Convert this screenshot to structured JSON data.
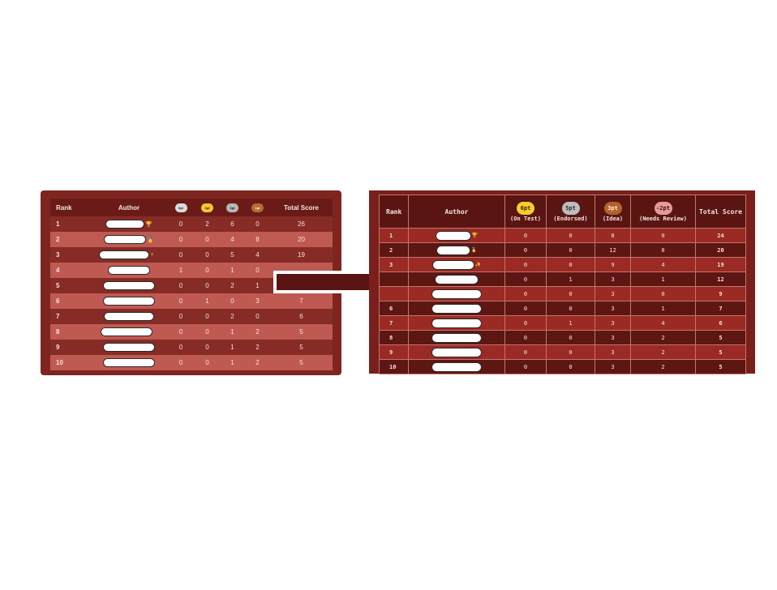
{
  "old_table": {
    "headers": {
      "rank": "Rank",
      "author": "Author",
      "badge_6pt": "6pt",
      "badge_4pt": "4pt",
      "badge_3pt": "3pt",
      "badge_1pt": "1pt",
      "total": "Total Score"
    },
    "rows": [
      {
        "rank": "1",
        "medal": "🏆",
        "c1": "0",
        "c2": "2",
        "c3": "6",
        "c4": "0",
        "total": "26"
      },
      {
        "rank": "2",
        "medal": "🥇",
        "c1": "0",
        "c2": "0",
        "c3": "4",
        "c4": "8",
        "total": "20"
      },
      {
        "rank": "3",
        "medal": "+",
        "c1": "0",
        "c2": "0",
        "c3": "5",
        "c4": "4",
        "total": "19"
      },
      {
        "rank": "4",
        "medal": "",
        "c1": "1",
        "c2": "0",
        "c3": "1",
        "c4": "0",
        "total": ""
      },
      {
        "rank": "5",
        "medal": "",
        "c1": "0",
        "c2": "0",
        "c3": "2",
        "c4": "1",
        "total": ""
      },
      {
        "rank": "6",
        "medal": "",
        "c1": "0",
        "c2": "1",
        "c3": "0",
        "c4": "3",
        "total": "7"
      },
      {
        "rank": "7",
        "medal": "",
        "c1": "0",
        "c2": "0",
        "c3": "2",
        "c4": "0",
        "total": "6"
      },
      {
        "rank": "8",
        "medal": "",
        "c1": "0",
        "c2": "0",
        "c3": "1",
        "c4": "2",
        "total": "5"
      },
      {
        "rank": "9",
        "medal": "",
        "c1": "0",
        "c2": "0",
        "c3": "1",
        "c4": "2",
        "total": "5"
      },
      {
        "rank": "10",
        "medal": "",
        "c1": "0",
        "c2": "0",
        "c3": "1",
        "c4": "2",
        "total": "5"
      }
    ]
  },
  "new_table": {
    "headers": {
      "rank": "Rank",
      "author": "Author",
      "badge_6pt": "6pt",
      "sub_6pt": "(On Test)",
      "badge_5pt": "5pt",
      "sub_5pt": "(Endorsed)",
      "badge_3pt": "3pt",
      "sub_3pt": "(Idea)",
      "badge_m2pt": "-2pt",
      "sub_m2pt": "(Needs Review)",
      "total": "Total Score"
    },
    "rows": [
      {
        "rank": "1",
        "medal": "🏆",
        "c1": "0",
        "c2": "0",
        "c3": "8",
        "c4": "0",
        "total": "24"
      },
      {
        "rank": "2",
        "medal": "🥇",
        "c1": "0",
        "c2": "0",
        "c3": "12",
        "c4": "8",
        "total": "20"
      },
      {
        "rank": "3",
        "medal": "✨",
        "c1": "0",
        "c2": "0",
        "c3": "9",
        "c4": "4",
        "total": "19"
      },
      {
        "rank": "",
        "medal": "",
        "c1": "0",
        "c2": "1",
        "c3": "3",
        "c4": "1",
        "total": "12"
      },
      {
        "rank": "",
        "medal": "",
        "c1": "0",
        "c2": "0",
        "c3": "3",
        "c4": "0",
        "total": "9"
      },
      {
        "rank": "6",
        "medal": "",
        "c1": "0",
        "c2": "0",
        "c3": "3",
        "c4": "1",
        "total": "7"
      },
      {
        "rank": "7",
        "medal": "",
        "c1": "0",
        "c2": "1",
        "c3": "3",
        "c4": "4",
        "total": "6"
      },
      {
        "rank": "8",
        "medal": "",
        "c1": "0",
        "c2": "0",
        "c3": "3",
        "c4": "2",
        "total": "5"
      },
      {
        "rank": "9",
        "medal": "",
        "c1": "0",
        "c2": "0",
        "c3": "3",
        "c4": "2",
        "total": "5"
      },
      {
        "rank": "10",
        "medal": "",
        "c1": "0",
        "c2": "0",
        "c3": "3",
        "c4": "2",
        "total": "5"
      }
    ]
  },
  "colors": {
    "old_row_odd": "#862b25",
    "old_row_even": "#bf5a52",
    "new_row_odd": "#9a2a23",
    "new_row_even": "#5e1613",
    "arrow_fill": "#5a1512"
  },
  "icons": {
    "arrow": "right-arrow-icon"
  }
}
